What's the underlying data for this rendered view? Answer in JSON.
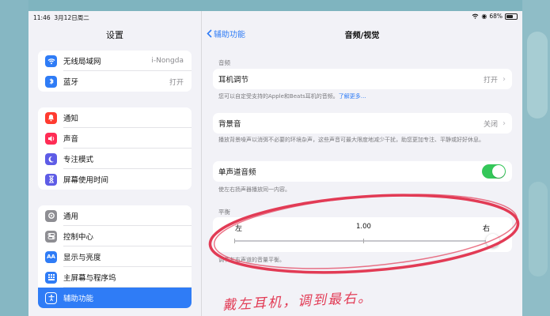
{
  "status": {
    "time": "11:46",
    "date": "3月12日周二",
    "battery": "68%"
  },
  "sidebar": {
    "title": "设置",
    "group1": [
      {
        "label": "无线局域网",
        "value": "i-Nongda",
        "icon": "wifi-icon",
        "color": "#2f7cf6"
      },
      {
        "label": "蓝牙",
        "value": "打开",
        "icon": "bluetooth-icon",
        "color": "#2f7cf6"
      }
    ],
    "group2": [
      {
        "label": "通知",
        "icon": "bell-icon",
        "color": "#ff3b30"
      },
      {
        "label": "声音",
        "icon": "speaker-icon",
        "color": "#ff2d55"
      },
      {
        "label": "专注模式",
        "icon": "moon-icon",
        "color": "#5e5ce6"
      },
      {
        "label": "屏幕使用时间",
        "icon": "hourglass-icon",
        "color": "#5e5ce6"
      }
    ],
    "group3": [
      {
        "label": "通用",
        "icon": "gear-icon",
        "color": "#8e8e93"
      },
      {
        "label": "控制中心",
        "icon": "toggles-icon",
        "color": "#8e8e93"
      },
      {
        "label": "显示与亮度",
        "icon": "aa-icon",
        "color": "#2f7cf6"
      },
      {
        "label": "主屏幕与程序坞",
        "icon": "grid-icon",
        "color": "#2f7cf6"
      },
      {
        "label": "辅助功能",
        "icon": "accessibility-icon",
        "color": "#2f7cf6",
        "selected": true
      }
    ]
  },
  "detail": {
    "back_label": "辅助功能",
    "title": "音频/视觉",
    "audio_section": "音频",
    "headphone": {
      "label": "耳机调节",
      "value": "打开"
    },
    "headphone_hint": "您可以自定受支持的Apple和Beats耳机的音频。",
    "headphone_link": "了解更多…",
    "background": {
      "label": "背景音",
      "value": "关闭"
    },
    "background_hint": "播放背景噪声以消弭不必要的环境杂声，这些声音可最大限度地减少干扰，助您更加专注、平静或好好休息。",
    "mono": {
      "label": "单声道音频",
      "on": true
    },
    "mono_hint": "使左右扬声器播放同一内容。",
    "balance_section": "平衡",
    "balance": {
      "left": "左",
      "value": "1.00",
      "right": "右",
      "level": 1.0
    },
    "balance_hint": "调节左右声道的音量平衡。"
  },
  "annotation": {
    "handwriting": "戴左耳机，调到最右。",
    "color": "#e23b55"
  }
}
